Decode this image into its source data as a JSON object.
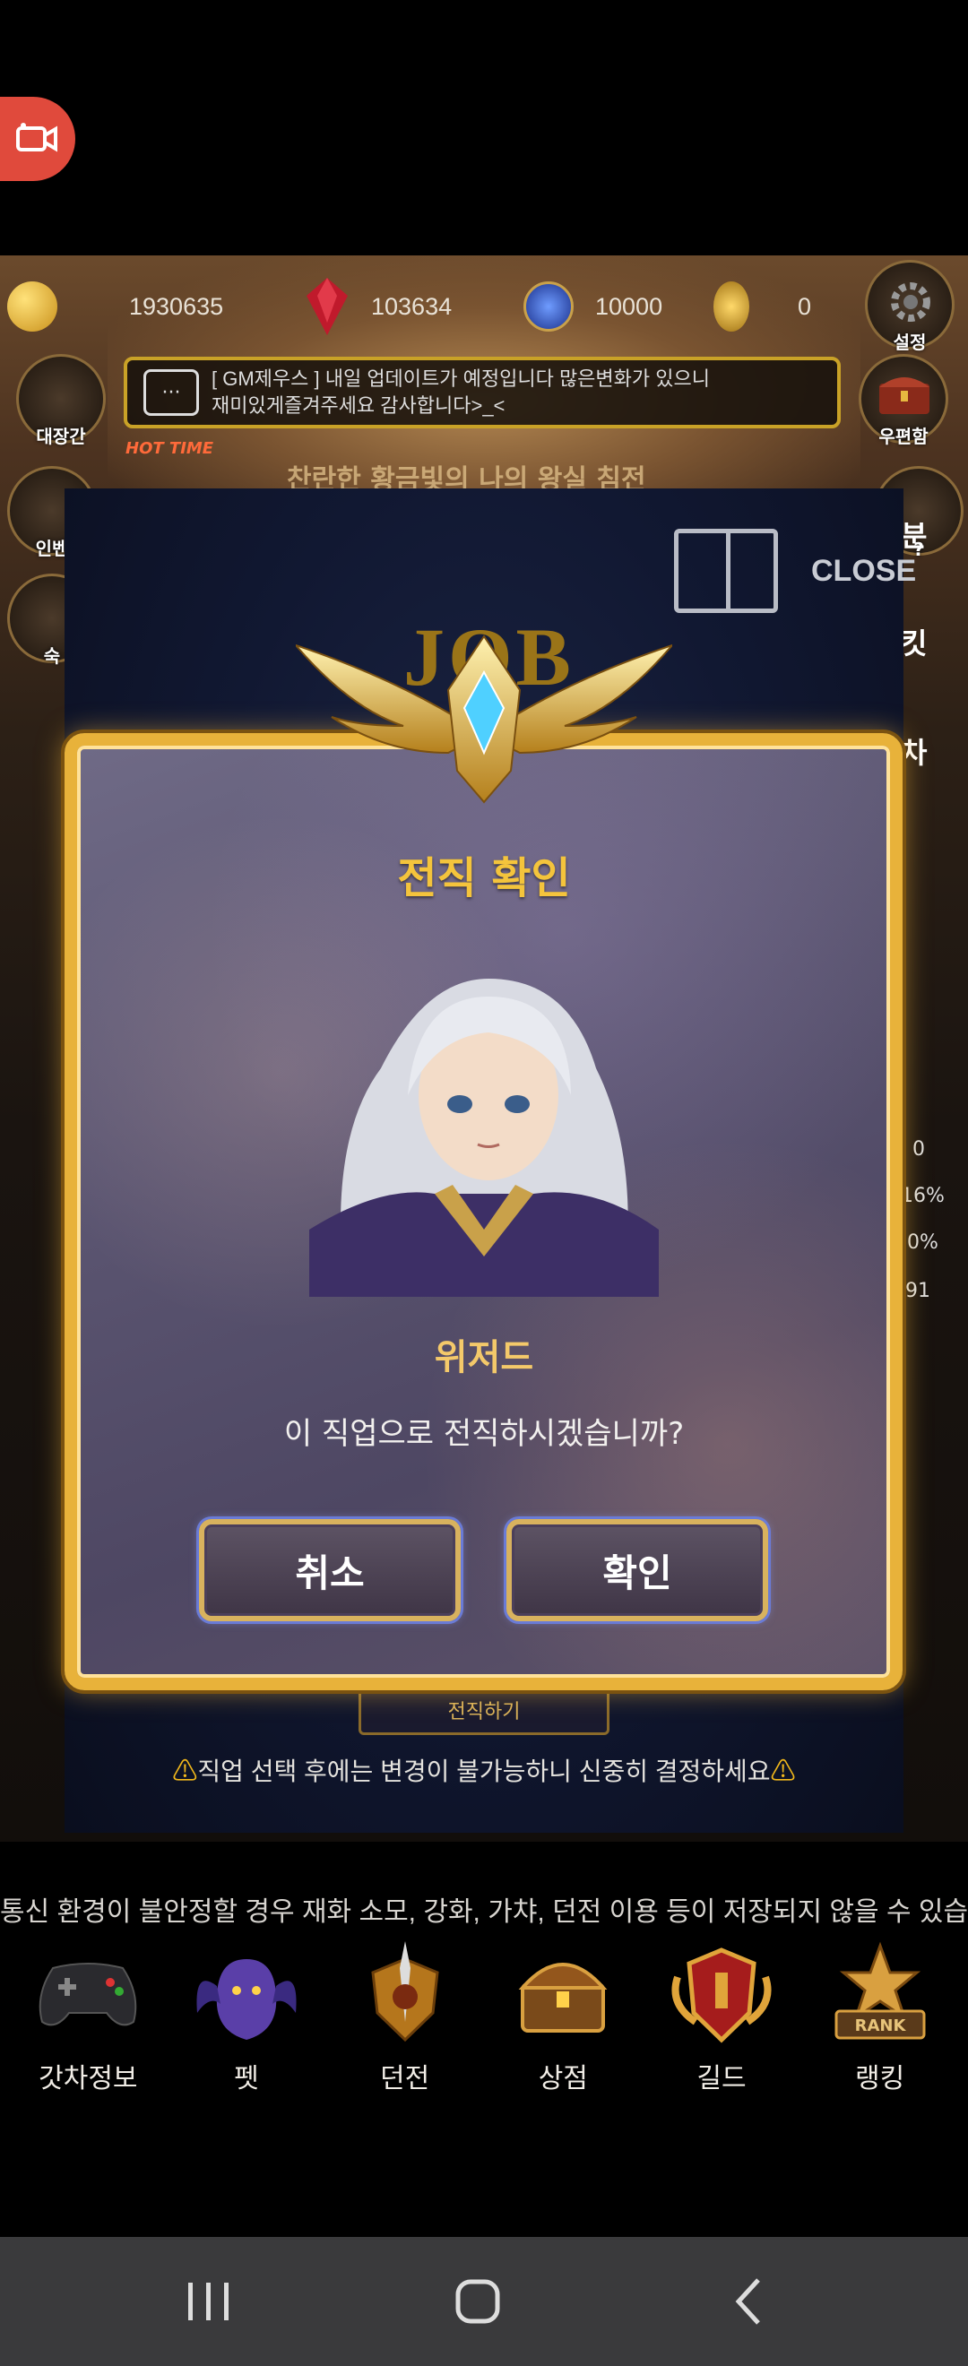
{
  "resources": {
    "gold": "1930635",
    "ruby": "103634",
    "crystal": "10000",
    "coupon": "0"
  },
  "side_buttons": {
    "settings": "설정",
    "arena": "대장간",
    "mailbox": "우편함",
    "inventory": "인벤",
    "left_partial": "숙",
    "right_partial_1": "분",
    "right_partial_2": "킷",
    "right_partial_3": "차",
    "help": "?",
    "hot_time": "HOT TIME"
  },
  "notice": {
    "line1": "[ GM제우스 ] 내일 업데이트가 예정입니다 많은변화가 있으니",
    "line2": "재미있게즐겨주세요 감사합니다>_<"
  },
  "hall_title": "찬란한 황금빛의 나의 왕실 침전",
  "job_panel": {
    "close_label": "CLOSE",
    "job_word": "JOB",
    "job_change_button": "전직하기",
    "warning": "직업 선택 후에는 변경이 불가능하니 신중히 결정하세요",
    "side_stats": [
      "0",
      "16%",
      "0%",
      "91"
    ]
  },
  "modal": {
    "title": "전직 확인",
    "class_name": "위저드",
    "question": "이 직업으로 전직하시겠습니까?",
    "cancel_label": "취소",
    "confirm_label": "확인"
  },
  "network_warning": "통신 환경이 불안정할 경우 재화 소모, 강화, 가챠, 던전 이용 등이 저장되지 않을 수 있습니다...",
  "nav": [
    {
      "label": "갓차정보",
      "icon": "gamepad-icon"
    },
    {
      "label": "펫",
      "icon": "dragon-icon"
    },
    {
      "label": "던전",
      "icon": "sword-shield-icon"
    },
    {
      "label": "상점",
      "icon": "treasure-chest-icon"
    },
    {
      "label": "길드",
      "icon": "guild-crest-icon"
    },
    {
      "label": "랭킹",
      "icon": "rank-badge-icon"
    }
  ],
  "colors": {
    "gold_accent": "#f4c43c",
    "modal_border": "#e8b23a",
    "record_button": "#e04a3c"
  }
}
